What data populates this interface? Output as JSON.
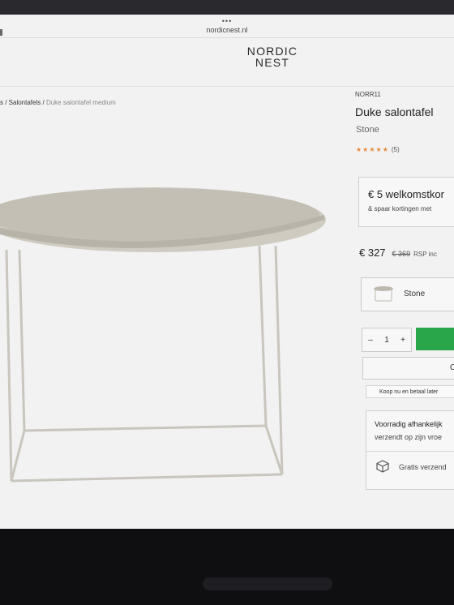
{
  "browser": {
    "url": "nordicnest.nl",
    "menu_dots": "•••"
  },
  "brand": {
    "line1": "NORDIC",
    "line2": "NEST"
  },
  "breadcrumb": {
    "prefix": "s / ",
    "category": "Salontafels",
    "separator": " / ",
    "current": "Duke salontafel medium"
  },
  "product": {
    "sku": "NORR11",
    "title": "Duke salontafel",
    "variant": "Stone",
    "rating_stars": "★★★★★",
    "rating_count": "(5)"
  },
  "promo": {
    "headline": "€ 5 welkomstkor",
    "subline": "& spaar kortingen met"
  },
  "price": {
    "current": "€ 327",
    "original": "€ 369",
    "note": "RSP inc"
  },
  "variant_selector": {
    "label": "Stone"
  },
  "quantity": {
    "minus": "–",
    "value": "1",
    "plus": "+"
  },
  "secondary_button": {
    "label": "C"
  },
  "klarna": {
    "label": "Koop nu en betaal later"
  },
  "stock": {
    "line1": "Voorradig afhankelijk",
    "line2": "verzendt op zijn vroe",
    "shipping": "Gratis verzend"
  },
  "colors": {
    "accent_green": "#2aa64a",
    "star_orange": "#e58b3c"
  }
}
